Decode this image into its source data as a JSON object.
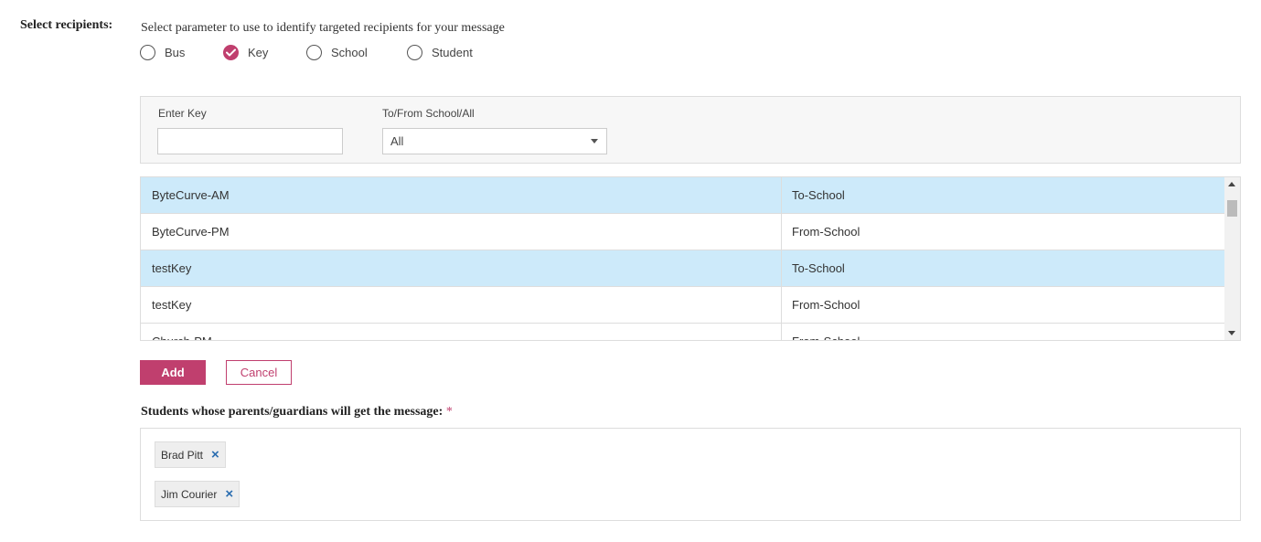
{
  "recipients": {
    "section_label": "Select recipients:",
    "instruction": "Select parameter to use to identify targeted recipients for your message",
    "options": [
      {
        "label": "Bus",
        "checked": false
      },
      {
        "label": "Key",
        "checked": true
      },
      {
        "label": "School",
        "checked": false
      },
      {
        "label": "Student",
        "checked": false
      }
    ]
  },
  "filters": {
    "key_label": "Enter Key",
    "key_value": "",
    "direction_label": "To/From School/All",
    "direction_selected": "All"
  },
  "key_list": {
    "rows": [
      {
        "key": "ByteCurve-AM",
        "direction": "To-School",
        "selected": true
      },
      {
        "key": "ByteCurve-PM",
        "direction": "From-School",
        "selected": false
      },
      {
        "key": "testKey",
        "direction": "To-School",
        "selected": true
      },
      {
        "key": "testKey",
        "direction": "From-School",
        "selected": false
      },
      {
        "key": "Church-PM",
        "direction": "From-School",
        "selected": false
      }
    ]
  },
  "actions": {
    "add_label": "Add",
    "cancel_label": "Cancel"
  },
  "students": {
    "label": "Students whose parents/guardians will get the message:",
    "required_marker": "*",
    "chips": [
      "Brad Pitt",
      "Jim Courier"
    ],
    "remove_glyph": "×"
  },
  "colors": {
    "accent": "#c03f6e",
    "selected_row": "#cdeafa",
    "remove_icon": "#2a6db0"
  },
  "icons": {
    "radio_checked": "check-icon",
    "select_caret": "caret-down-icon",
    "chip_remove": "close-icon"
  }
}
